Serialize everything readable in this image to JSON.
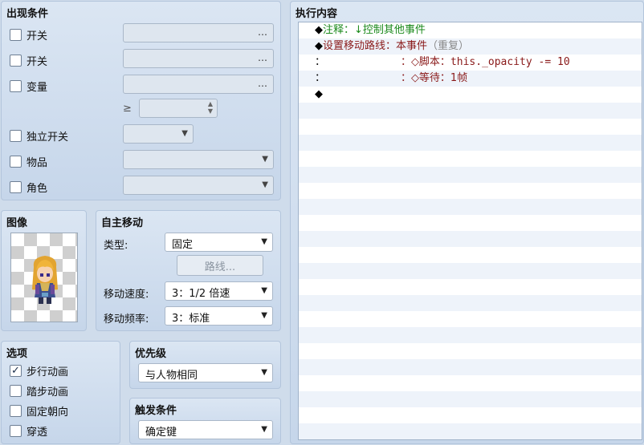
{
  "conditions": {
    "title": "出现条件",
    "switch1_label": "开关",
    "switch2_label": "开关",
    "variable_label": "变量",
    "gte_symbol": "≥",
    "self_switch_label": "独立开关",
    "item_label": "物品",
    "actor_label": "角色",
    "ellipsis": "…"
  },
  "image": {
    "title": "图像"
  },
  "autonomous": {
    "title": "自主移动",
    "type_label": "类型:",
    "type_value": "固定",
    "route_button": "路线...",
    "speed_label": "移动速度:",
    "speed_value": "3：1/2 倍速",
    "freq_label": "移动频率:",
    "freq_value": "3：标准"
  },
  "options": {
    "title": "选项",
    "walking": "步行动画",
    "stepping": "踏步动画",
    "direction_fix": "固定朝向",
    "through": "穿透",
    "walking_checked": "✓"
  },
  "priority": {
    "title": "优先级",
    "value": "与人物相同"
  },
  "trigger": {
    "title": "触发条件",
    "value": "确定键"
  },
  "exec": {
    "title": "执行内容",
    "line1_marker": "◆",
    "line1_text": "注释：↓控制其他事件",
    "line2_marker": "◆",
    "line2_text": "设置移动路线：本事件",
    "line2_suffix": "（重复）",
    "line3_prefix": "：",
    "line3_mid": "：◇脚本：",
    "line3_code": "this._opacity -= 10",
    "line4_prefix": "：",
    "line4_text": "：◇等待：1帧",
    "line5_marker": "◆"
  },
  "colors": {
    "comment": "#1c8a1c",
    "command": "#8a1a1a",
    "panel_bg": "#cfdceb"
  }
}
